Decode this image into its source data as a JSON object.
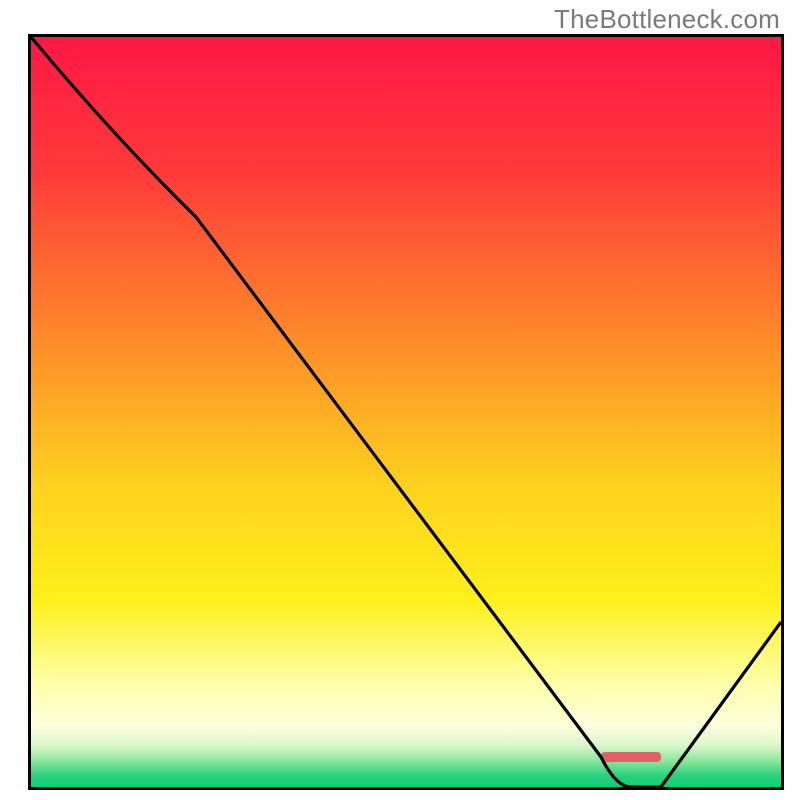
{
  "watermark": "TheBottleneck.com",
  "chart_data": {
    "type": "line",
    "title": "",
    "xlabel": "",
    "ylabel": "",
    "xlim": [
      0,
      100
    ],
    "ylim": [
      0,
      100
    ],
    "x": [
      0,
      22,
      76,
      80,
      84,
      100
    ],
    "values": [
      100,
      76,
      4,
      0,
      0,
      22
    ],
    "marker": {
      "x_start": 76,
      "x_end": 84,
      "y": 4
    },
    "gradient_stops": [
      {
        "offset": 0.0,
        "color": "#ff1745"
      },
      {
        "offset": 0.18,
        "color": "#ff3a3a"
      },
      {
        "offset": 0.4,
        "color": "#ff8a2a"
      },
      {
        "offset": 0.6,
        "color": "#ffd21f"
      },
      {
        "offset": 0.75,
        "color": "#fff01a"
      },
      {
        "offset": 0.86,
        "color": "#ffffa8"
      },
      {
        "offset": 0.92,
        "color": "#ffffe0"
      },
      {
        "offset": 0.945,
        "color": "#d8f7c8"
      },
      {
        "offset": 0.965,
        "color": "#8be79e"
      },
      {
        "offset": 0.985,
        "color": "#27d17a"
      },
      {
        "offset": 1.0,
        "color": "#0ccf77"
      }
    ],
    "marker_color": "#e0616c"
  }
}
